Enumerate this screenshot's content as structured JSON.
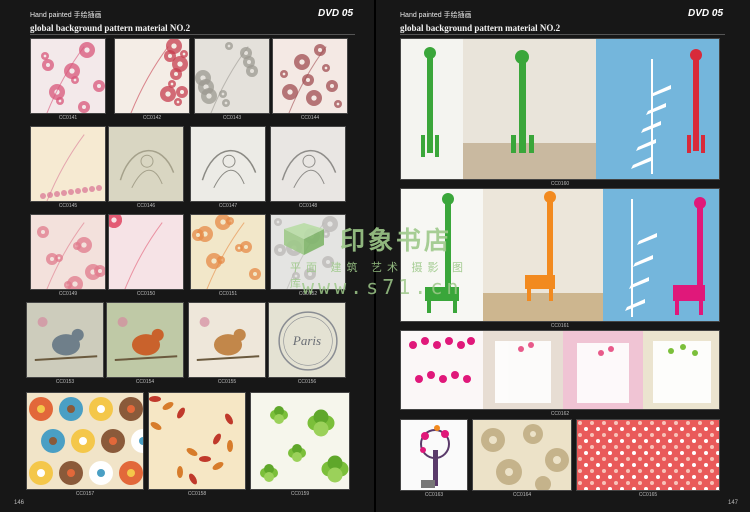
{
  "left_page": {
    "header_label": "Hand painted 手绘插画",
    "dvd_label": "DVD 05",
    "series_title": "global background pattern material NO.2",
    "page_number": "146",
    "thumbnails": [
      {
        "code": "CC0141",
        "bg": "#f3e9ea",
        "accent": "#d8557a",
        "motif": "floral"
      },
      {
        "code": "CC0142",
        "bg": "#f4ede6",
        "accent": "#c73d4f",
        "motif": "floral"
      },
      {
        "code": "CC0143",
        "bg": "#e4e1db",
        "accent": "#9c9a92",
        "motif": "floral"
      },
      {
        "code": "CC0144",
        "bg": "#f4e9e4",
        "accent": "#a04c52",
        "motif": "floral"
      },
      {
        "code": "CC0145",
        "bg": "#f6ead2",
        "accent": "#d97896",
        "motif": "dots"
      },
      {
        "code": "CC0146",
        "bg": "#d9d6c2",
        "accent": "#a5a18b",
        "motif": "swirl"
      },
      {
        "code": "CC0147",
        "bg": "#ecebe6",
        "accent": "#8b8a84",
        "motif": "swirl"
      },
      {
        "code": "CC0148",
        "bg": "#e9e6e3",
        "accent": "#8f8d8a",
        "motif": "swirl"
      },
      {
        "code": "CC0149",
        "bg": "#f3e1dc",
        "accent": "#e07a8c",
        "motif": "floral"
      },
      {
        "code": "CC0150",
        "bg": "#f6e3e6",
        "accent": "#e35b74",
        "motif": "floral"
      },
      {
        "code": "CC0151",
        "bg": "#f2e7c9",
        "accent": "#e68a45",
        "motif": "floral"
      },
      {
        "code": "CC0152",
        "bg": "#e4e4e2",
        "accent": "#b9b7b4",
        "motif": "floral"
      },
      {
        "code": "CC0153",
        "bg": "#cdccbc",
        "accent": "#6f7f8a",
        "motif": "bird"
      },
      {
        "code": "CC0154",
        "bg": "#bfc9a6",
        "accent": "#c9622c",
        "motif": "bird"
      },
      {
        "code": "CC0155",
        "bg": "#eee7da",
        "accent": "#c2874a",
        "motif": "bird"
      },
      {
        "code": "CC0156",
        "bg": "#e4e2d3",
        "accent": "#8a8d93",
        "motif": "badge",
        "text": "Paris"
      },
      {
        "code": "CC0157",
        "bg": "#f1e4c8",
        "accent": "#e2683a",
        "motif": "bigflower"
      },
      {
        "code": "CC0158",
        "bg": "#f6e7c5",
        "accent": "#d77c2b",
        "motif": "leaves"
      },
      {
        "code": "CC0159",
        "bg": "#f6f6ec",
        "accent": "#7bbf3a",
        "motif": "clover"
      }
    ]
  },
  "right_page": {
    "header_label": "Hand painted 手绘插画",
    "dvd_label": "DVD 05",
    "series_title": "global background pattern material NO.2",
    "page_number": "147",
    "thumbnails": [
      {
        "code": "CC0160",
        "kind": "giraffe-wall"
      },
      {
        "code": "CC0161",
        "kind": "giraffe-color"
      },
      {
        "code": "CC0162",
        "kind": "hearts-room"
      },
      {
        "code": "CC0163",
        "kind": "tree-sticker"
      },
      {
        "code": "CC0164",
        "kind": "beige-floral"
      },
      {
        "code": "CC0165",
        "kind": "red-pattern"
      }
    ]
  },
  "watermark": {
    "brand": "印象书店",
    "subtitle": "平面 建筑 艺术 摄影 图库",
    "url": "www.s71.cn"
  },
  "colors": {
    "background": "#171717",
    "watermark_green": "#9ec98a",
    "giraffe_green": "#3aa63a",
    "giraffe_red": "#d82a3a",
    "sky_blue": "#74b6dc",
    "orange": "#f28a1f",
    "magenta": "#e0187a"
  }
}
